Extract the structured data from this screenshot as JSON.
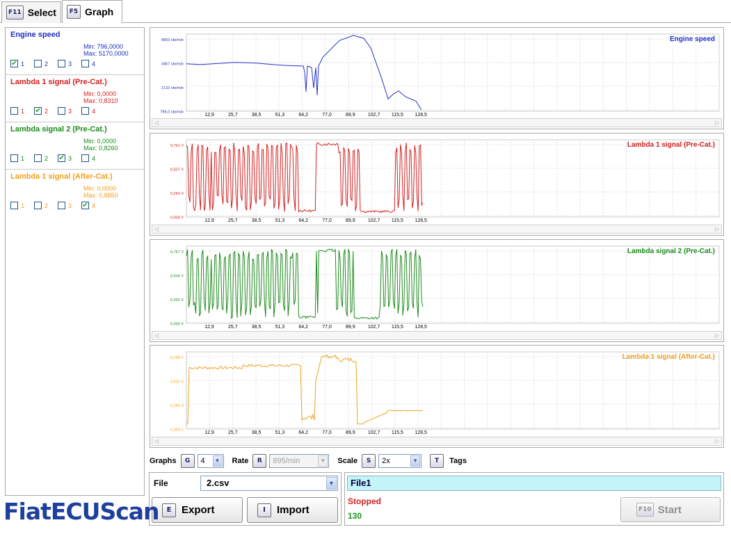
{
  "tabs": [
    {
      "key": "F11",
      "label": "Select"
    },
    {
      "key": "F5",
      "label": "Graph"
    }
  ],
  "signals": [
    {
      "title": "Engine speed",
      "color": "#1f2fbf",
      "min": "Min: 796,0000",
      "max": "Max: 5170,0000",
      "checks": [
        "1",
        "2",
        "3",
        "4"
      ],
      "checked": 0
    },
    {
      "title": "Lambda 1 signal (Pre-Cat.)",
      "color": "#d42020",
      "min": "Min: 0,0000",
      "max": "Max: 0,8310",
      "checks": [
        "1",
        "2",
        "3",
        "4"
      ],
      "checked": 1
    },
    {
      "title": "Lambda signal 2 (Pre-Cat.)",
      "color": "#1c8a1c",
      "min": "Min: 0,0000",
      "max": "Max: 0,8260",
      "checks": [
        "1",
        "2",
        "3",
        "4"
      ],
      "checked": 2
    },
    {
      "title": "Lambda 1 signal (After-Cat.)",
      "color": "#f0a020",
      "min": "Min: 0,0000",
      "max": "Max: 0,8850",
      "checks": [
        "1",
        "2",
        "3",
        "4"
      ],
      "checked": 3
    }
  ],
  "graphs": [
    {
      "title": "Engine speed",
      "color": "#2030c8",
      "yticks": [
        "4803 obr/min",
        "3467 obr/min",
        "2132 obr/min",
        "796,0 obr/min"
      ]
    },
    {
      "title": "Lambda 1 signal (Pre-Cat.)",
      "color": "#d42020",
      "yticks": [
        "0,761 V",
        "0,507 V",
        "0,254 V",
        "0,000 V"
      ]
    },
    {
      "title": "Lambda signal 2 (Pre-Cat.)",
      "color": "#1c8a1c",
      "yticks": [
        "0,757 V",
        "0,504 V",
        "0,252 V",
        "0,000 V"
      ]
    },
    {
      "title": "Lambda 1 signal (After-Cat.)",
      "color": "#f0a020",
      "yticks": [
        "0,798 V",
        "0,532 V",
        "0,266 V",
        "0,000 V"
      ]
    }
  ],
  "xticks": [
    "12,9",
    "25,7",
    "38,5",
    "51,3",
    "64,2",
    "77,0",
    "89,9",
    "102,7",
    "115,5",
    "128,5"
  ],
  "controls": {
    "graphs_label": "Graphs",
    "graphs_key": "G",
    "graphs_value": "4",
    "rate_label": "Rate",
    "rate_key": "R",
    "rate_value": "895/min",
    "scale_label": "Scale",
    "scale_key": "S",
    "scale_value": "2x",
    "tags_key": "T",
    "tags_label": "Tags"
  },
  "file": {
    "label": "File",
    "value": "2.csv",
    "export_key": "E",
    "export_label": "Export",
    "import_key": "I",
    "import_label": "Import"
  },
  "status": {
    "file_name": "File1",
    "state": "Stopped",
    "count": "130",
    "start_key": "F10",
    "start_label": "Start"
  },
  "logo": "FiatECUScan"
}
